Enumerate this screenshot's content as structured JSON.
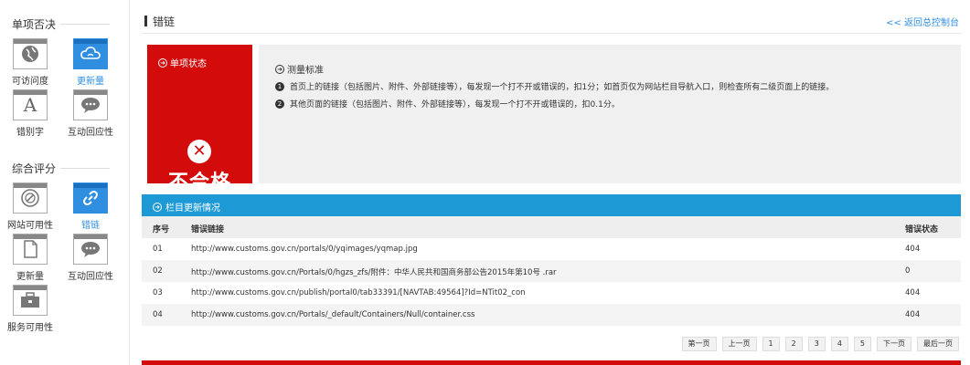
{
  "sidebar": {
    "section1_title": "单项否决",
    "section1_items": [
      {
        "label": "可访问度",
        "icon": "globe-icon",
        "active": false
      },
      {
        "label": "更新量",
        "icon": "cloud-icon",
        "active": true
      },
      {
        "label": "错别字",
        "icon": "letter-a-icon",
        "active": false
      },
      {
        "label": "互动回应性",
        "icon": "chat-icon",
        "active": false
      }
    ],
    "section2_title": "综合评分",
    "section2_items": [
      {
        "label": "网站可用性",
        "icon": "compass-icon",
        "active": false
      },
      {
        "label": "错链",
        "icon": "link-icon",
        "active": true
      },
      {
        "label": "更新量",
        "icon": "document-icon",
        "active": false
      },
      {
        "label": "互动回应性",
        "icon": "chat-icon",
        "active": false
      },
      {
        "label": "服务可用性",
        "icon": "toolbox-icon",
        "active": false
      }
    ]
  },
  "header": {
    "title": "错链",
    "back_link": "<< 返回总控制台"
  },
  "status": {
    "heading": "单项状态",
    "result": "不合格"
  },
  "criteria": {
    "heading": "测量标准",
    "items": [
      {
        "num": "1",
        "text": "首页上的链接（包括图片、附件、外部链接等），每发现一个打不开或错误的，扣1分；如首页仅为网站栏目导航入口，则检查所有二级页面上的链接。"
      },
      {
        "num": "2",
        "text": "其他页面的链接（包括图片、附件、外部链接等），每发现一个打不开或错误的，扣0.1分。"
      }
    ]
  },
  "section": {
    "title": "栏目更新情况"
  },
  "table": {
    "headers": [
      "序号",
      "错误链接",
      "错误状态"
    ],
    "rows": [
      {
        "no": "01",
        "link": "http://www.customs.gov.cn/portals/0/yqimages/yqmap.jpg",
        "status": "404"
      },
      {
        "no": "02",
        "link": "http://www.customs.gov.cn/Portals/0/hgzs_zfs/附件：中华人民共和国商务部公告2015年第10号 .rar",
        "status": "0"
      },
      {
        "no": "03",
        "link": "http://www.customs.gov.cn/publish/portal0/tab33391/[NAVTAB:49564]?Id=NTit02_con",
        "status": "404"
      },
      {
        "no": "04",
        "link": "http://www.customs.gov.cn/Portals/_default/Containers/Null/container.css",
        "status": "404"
      }
    ]
  },
  "pagination": {
    "first": "第一页",
    "prev": "上一页",
    "pages": [
      "1",
      "2",
      "3",
      "4",
      "5"
    ],
    "next": "下一页",
    "last": "最后一页"
  },
  "colors": {
    "accent_blue": "#1d9ad6",
    "fail_red": "#d40b0b"
  }
}
